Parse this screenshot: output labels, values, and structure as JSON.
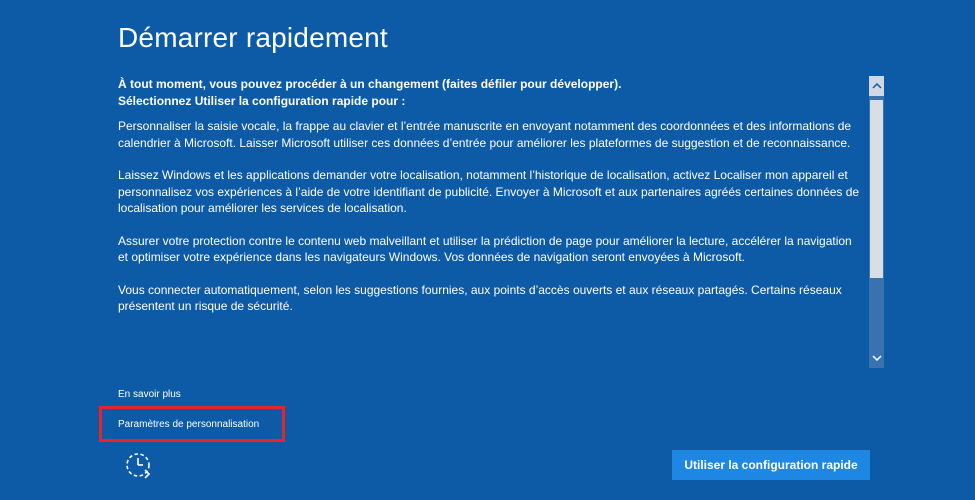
{
  "page": {
    "title": "Démarrer rapidement"
  },
  "content": {
    "intro_line1": "À tout moment, vous pouvez procéder à un changement (faites défiler pour développer).",
    "intro_line2": "Sélectionnez Utiliser la configuration rapide pour :",
    "paragraphs": [
      "Personnaliser la saisie vocale, la frappe au clavier et l’entrée manuscrite en envoyant notamment des coordonnées et des informations de calendrier à Microsoft. Laisser Microsoft utiliser ces données d’entrée pour améliorer les plateformes de suggestion et de reconnaissance.",
      "Laissez Windows et les applications demander votre localisation, notamment l’historique de localisation, activez Localiser mon appareil et personnalisez vos expériences à l’aide de votre identifiant de publicité. Envoyer à Microsoft et aux partenaires agréés certaines données de localisation pour améliorer les services de localisation.",
      "Assurer votre protection contre le contenu web malveillant et utiliser la prédiction de page pour améliorer la lecture, accélérer la navigation et optimiser votre expérience dans les navigateurs Windows. Vos données de navigation seront envoyées à Microsoft.",
      "Vous connecter automatiquement, selon les suggestions fournies, aux points d’accès ouverts et aux réseaux partagés. Certains réseaux présentent un risque de sécurité."
    ]
  },
  "links": {
    "learn_more": "En savoir plus",
    "customize": "Paramètres de personnalisation"
  },
  "buttons": {
    "express": "Utiliser la configuration rapide"
  },
  "icons": {
    "ease_of_access": "ease-of-access-icon",
    "scroll_up": "chevron-up-icon",
    "scroll_down": "chevron-down-icon"
  },
  "colors": {
    "background": "#0d5aa7",
    "button": "#1e86e3",
    "highlight": "#e8232a"
  }
}
